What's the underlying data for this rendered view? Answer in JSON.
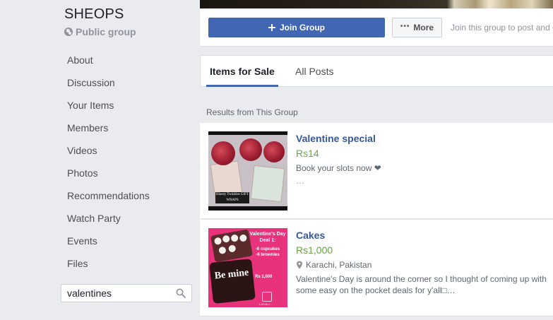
{
  "group": {
    "name": "SHEOPS",
    "privacy": "Public group"
  },
  "sidebar": {
    "items": [
      {
        "label": "About"
      },
      {
        "label": "Discussion"
      },
      {
        "label": "Your Items"
      },
      {
        "label": "Members"
      },
      {
        "label": "Videos"
      },
      {
        "label": "Photos"
      },
      {
        "label": "Recommendations"
      },
      {
        "label": "Watch Party"
      },
      {
        "label": "Events"
      },
      {
        "label": "Files"
      }
    ],
    "search": {
      "value": "valentines",
      "icon": "search-icon"
    }
  },
  "actions": {
    "join_label": "Join Group",
    "join_icon": "plus-icon",
    "more_label": "More",
    "more_icon": "ellipsis-icon",
    "hint": "Join this group to post and c"
  },
  "tabs": [
    {
      "label": "Items for Sale",
      "active": true
    },
    {
      "label": "All Posts",
      "active": false
    }
  ],
  "results_header": "Results from This Group",
  "listings": [
    {
      "title": "Valentine special",
      "price": "Rs14",
      "description": "Book your slots now ❤",
      "ellipsis": "…",
      "thumb_text": "Hlaeey Twinkles GIFT WRAPS"
    },
    {
      "title": "Cakes",
      "price": "Rs1,000",
      "location": "Karachi, Pakistan",
      "description": "Valentine's Day is around the corner so I thought of coming up with some easy on the pocket deals for y'all□…",
      "thumb": {
        "deal_title": "Valentine's Day Deal 1:",
        "line1": "-6 cupcakes",
        "line2": "-6 brownies",
        "price": "Rs 1,000",
        "be_mine": "Be mine",
        "logo": "LAYALI"
      }
    }
  ],
  "colors": {
    "brand_blue": "#4267b2",
    "link_blue": "#365899",
    "price_green": "#6da34d",
    "background": "#e9ebee"
  }
}
